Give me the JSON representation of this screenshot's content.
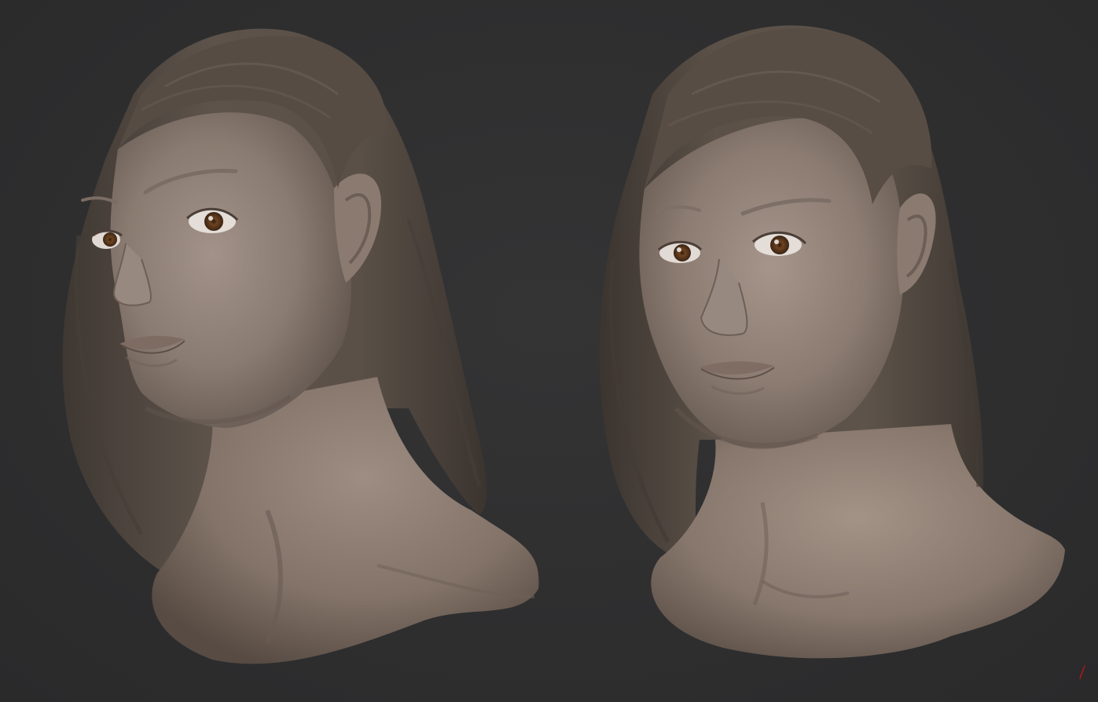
{
  "scene": {
    "background_color": "#2e2e2f",
    "material_color": "#8a7a6e",
    "hair_color": "#5e534b",
    "iris_color": "#7a4a24",
    "signature_color": "#b01818"
  },
  "busts": [
    {
      "view": "three-quarter-left"
    },
    {
      "view": "near-front"
    }
  ],
  "signature": {
    "icon": "signature-mark-icon"
  }
}
